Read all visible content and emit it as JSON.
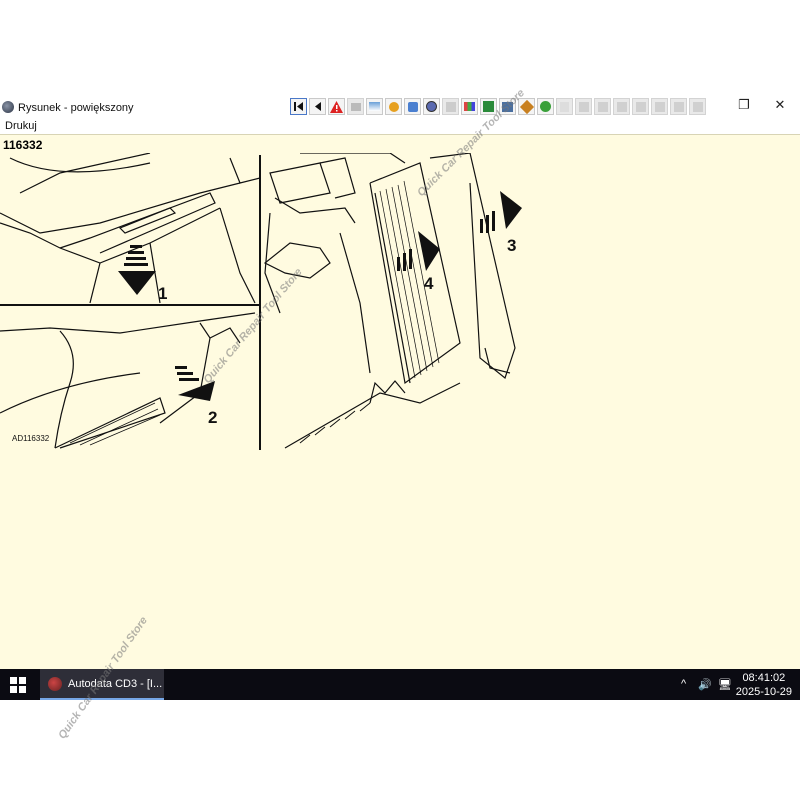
{
  "window": {
    "title": "Rysunek - powiększony"
  },
  "menu": {
    "print": "Drukuj"
  },
  "toolbar": {
    "icons": [
      "first-page",
      "prev-page",
      "warning",
      "images",
      "tool-1",
      "tool-2",
      "tool-3",
      "tool-4",
      "tool-5",
      "tool-6",
      "tool-7",
      "tool-8",
      "tool-9",
      "tool-10",
      "tool-11",
      "tool-12",
      "tool-13",
      "tool-14",
      "tool-15",
      "tool-16",
      "tool-17",
      "tool-18"
    ]
  },
  "figure": {
    "number": "116332",
    "code": "AD116332",
    "callouts": [
      "1",
      "2",
      "3",
      "4"
    ]
  },
  "taskbar": {
    "app_label": "Autodata CD3 - [I...",
    "time": "08:41:02",
    "date": "2025-10-29"
  },
  "watermark": {
    "text": "Quick Car Repair Tool Store"
  },
  "colors": {
    "content_bg": "#fffbe0",
    "taskbar_bg": "#0b0b12"
  }
}
